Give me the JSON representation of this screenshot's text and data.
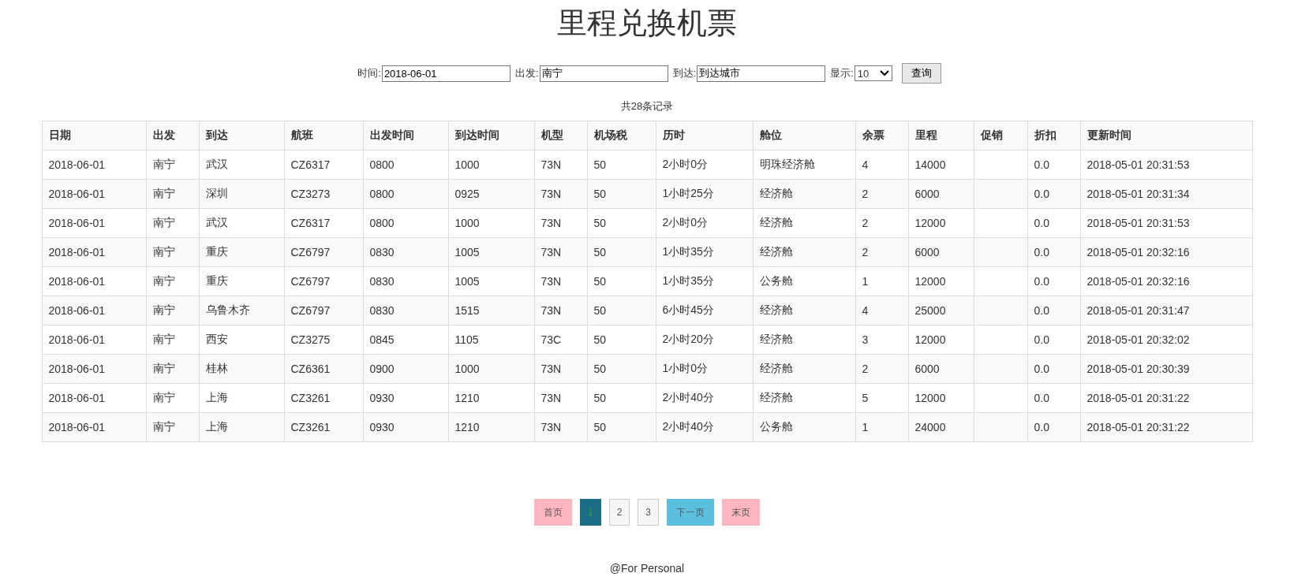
{
  "title": "里程兑换机票",
  "search": {
    "fields": [
      {
        "label": "时间:",
        "value": "2018-06-01"
      },
      {
        "label": "出发:",
        "value": "南宁"
      },
      {
        "label": "到达:",
        "value": "到达城市"
      }
    ],
    "display": {
      "label": "显示:",
      "value": "10"
    },
    "button": "查询"
  },
  "record_count": "共28条记录",
  "table": {
    "columns": [
      "日期",
      "出发",
      "到达",
      "航班",
      "出发时间",
      "到达时间",
      "机型",
      "机场税",
      "历时",
      "舱位",
      "余票",
      "里程",
      "促销",
      "折扣",
      "更新时间"
    ],
    "rows": [
      [
        "2018-06-01",
        "南宁",
        "武汉",
        "CZ6317",
        "0800",
        "1000",
        "73N",
        "50",
        "2小时0分",
        "明珠经济舱",
        "4",
        "14000",
        "",
        "0.0",
        "2018-05-01 20:31:53"
      ],
      [
        "2018-06-01",
        "南宁",
        "深圳",
        "CZ3273",
        "0800",
        "0925",
        "73N",
        "50",
        "1小时25分",
        "经济舱",
        "2",
        "6000",
        "",
        "0.0",
        "2018-05-01 20:31:34"
      ],
      [
        "2018-06-01",
        "南宁",
        "武汉",
        "CZ6317",
        "0800",
        "1000",
        "73N",
        "50",
        "2小时0分",
        "经济舱",
        "2",
        "12000",
        "",
        "0.0",
        "2018-05-01 20:31:53"
      ],
      [
        "2018-06-01",
        "南宁",
        "重庆",
        "CZ6797",
        "0830",
        "1005",
        "73N",
        "50",
        "1小时35分",
        "经济舱",
        "2",
        "6000",
        "",
        "0.0",
        "2018-05-01 20:32:16"
      ],
      [
        "2018-06-01",
        "南宁",
        "重庆",
        "CZ6797",
        "0830",
        "1005",
        "73N",
        "50",
        "1小时35分",
        "公务舱",
        "1",
        "12000",
        "",
        "0.0",
        "2018-05-01 20:32:16"
      ],
      [
        "2018-06-01",
        "南宁",
        "乌鲁木齐",
        "CZ6797",
        "0830",
        "1515",
        "73N",
        "50",
        "6小时45分",
        "经济舱",
        "4",
        "25000",
        "",
        "0.0",
        "2018-05-01 20:31:47"
      ],
      [
        "2018-06-01",
        "南宁",
        "西安",
        "CZ3275",
        "0845",
        "1105",
        "73C",
        "50",
        "2小时20分",
        "经济舱",
        "3",
        "12000",
        "",
        "0.0",
        "2018-05-01 20:32:02"
      ],
      [
        "2018-06-01",
        "南宁",
        "桂林",
        "CZ6361",
        "0900",
        "1000",
        "73N",
        "50",
        "1小时0分",
        "经济舱",
        "2",
        "6000",
        "",
        "0.0",
        "2018-05-01 20:30:39"
      ],
      [
        "2018-06-01",
        "南宁",
        "上海",
        "CZ3261",
        "0930",
        "1210",
        "73N",
        "50",
        "2小时40分",
        "经济舱",
        "5",
        "12000",
        "",
        "0.0",
        "2018-05-01 20:31:22"
      ],
      [
        "2018-06-01",
        "南宁",
        "上海",
        "CZ3261",
        "0930",
        "1210",
        "73N",
        "50",
        "2小时40分",
        "公务舱",
        "1",
        "24000",
        "",
        "0.0",
        "2018-05-01 20:31:22"
      ]
    ]
  },
  "pagination": [
    {
      "label": "首页",
      "kind": "end",
      "selected": false
    },
    {
      "label": "1",
      "kind": "page",
      "selected": true
    },
    {
      "label": "2",
      "kind": "page",
      "selected": false
    },
    {
      "label": "3",
      "kind": "page",
      "selected": false
    },
    {
      "label": "下一页",
      "kind": "next",
      "selected": false
    },
    {
      "label": "末页",
      "kind": "end",
      "selected": false
    }
  ],
  "footer": "@For Personal"
}
